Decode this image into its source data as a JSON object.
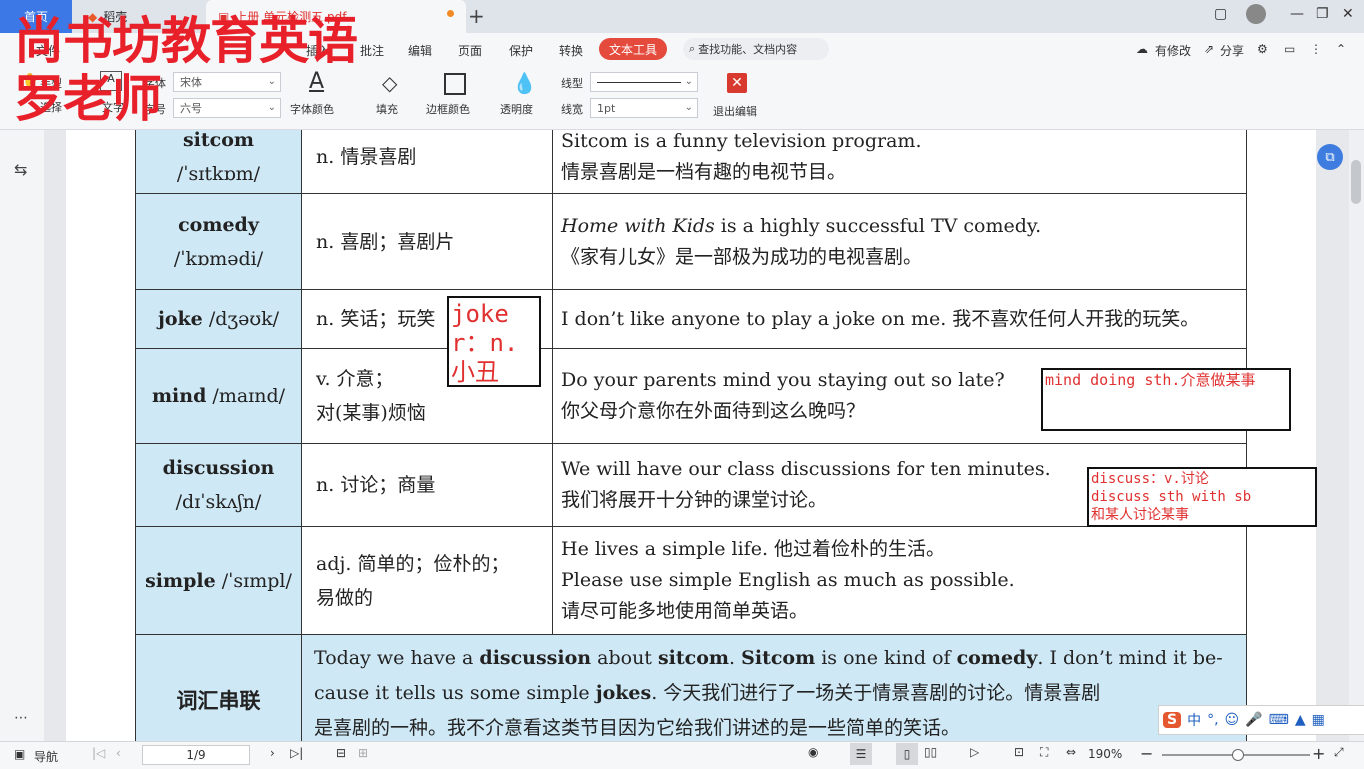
{
  "tabs": {
    "home": "首页",
    "daoke": "稻壳",
    "pdf": "上册 单元检测五.pdf",
    "new": "+"
  },
  "menus": [
    "文件",
    "",
    "插入",
    "批注",
    "编辑",
    "页面",
    "保护",
    "转换"
  ],
  "menu_active": "文本工具",
  "search_placeholder": "查找功能、文档内容",
  "right_menu": {
    "modified": "有修改",
    "share": "分享"
  },
  "toolbar": {
    "hand": "手型",
    "select": "选择",
    "edit_text": "文字",
    "font_label": "字体",
    "font_value": "宋体",
    "size_label": "字号",
    "size_value": "六号",
    "font_color": "字体颜色",
    "fill": "填充",
    "border_color": "边框颜色",
    "opacity": "透明度",
    "line_type": "线型",
    "line_width": "线宽",
    "line_width_value": "1pt",
    "exit_edit": "退出编辑"
  },
  "watermark": {
    "line1": "尚书坊教育英语",
    "line2": "罗老师"
  },
  "rows": [
    {
      "word": "sitcom",
      "ipa": "/ˈsɪtkɒm/",
      "meaning": "n. 情景喜剧",
      "ex1": "Sitcom is a funny television program.",
      "ex2": "情景喜剧是一档有趣的电视节目。"
    },
    {
      "word": "comedy",
      "ipa": "/ˈkɒmədi/",
      "meaning": "n. 喜剧；喜剧片",
      "ex1_italic": "Home with Kids",
      "ex1": " is a highly successful TV comedy.",
      "ex2": "《家有儿女》是一部极为成功的电视喜剧。"
    },
    {
      "word": "joke",
      "ipa": "/dʒəʊk/",
      "meaning": "n. 笑话；玩笑",
      "ex1": "I don’t like anyone to play a joke on me. 我不喜欢任何人开我的玩笑。"
    },
    {
      "word": "mind",
      "ipa": "/maɪnd/",
      "meaning1": "v. 介意；",
      "meaning2": "对(某事)烦恼",
      "ex1": "Do your parents mind you staying out so late?",
      "ex2": "你父母介意你在外面待到这么晚吗？"
    },
    {
      "word": "discussion",
      "ipa": "/dɪˈskʌʃn/",
      "meaning": "n. 讨论；商量",
      "ex1": "We will have our class discussions for ten minutes.",
      "ex2": "我们将展开十分钟的课堂讨论。"
    },
    {
      "word": "simple",
      "ipa": "/ˈsɪmpl/",
      "meaning1": "adj. 简单的；俭朴的；",
      "meaning2": "易做的",
      "ex1": "He lives a simple life. 他过着俭朴的生活。",
      "ex2": "Please use simple English as much as possible.",
      "ex3": "请尽可能多地使用简单英语。"
    }
  ],
  "summary": {
    "head": "词汇串联",
    "t1": "Today we have a ",
    "b1": "discussion",
    "t2": " about ",
    "b2": "sitcom",
    "t3": ". ",
    "b3": "Sitcom",
    "t4": " is one kind of ",
    "b4": "comedy",
    "t5": ". I don’t mind it be-",
    "t6": "cause it tells us some simple ",
    "b5": "jokes",
    "t7": ". 今天我们进行了一场关于情景喜剧的讨论。情景喜剧",
    "t8": "是喜剧的一种。我不介意看这类节目因为它给我们讲述的是一些简单的笑话。"
  },
  "annotations": {
    "joker": "joker：n. 小丑",
    "mind_note": "mind doing sth.介意做某事",
    "discuss1": "discuss：v.讨论",
    "discuss2": "discuss sth with sb",
    "discuss3": "和某人讨论某事"
  },
  "status": {
    "nav": "导航",
    "page": "1/9",
    "zoom": "190%"
  },
  "ime": "中"
}
